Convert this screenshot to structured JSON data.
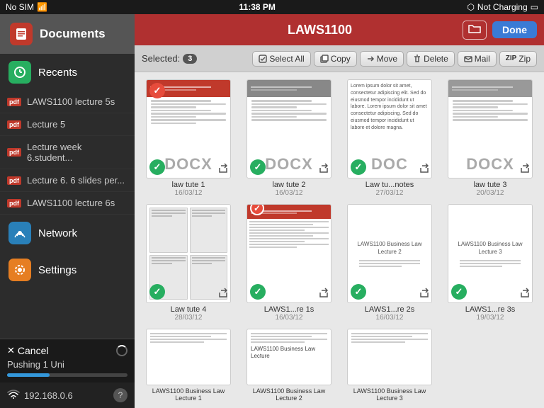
{
  "status_bar": {
    "left": "No SIM",
    "center": "11:38 PM",
    "right": "Not Charging"
  },
  "sidebar": {
    "title": "Documents",
    "documents_label": "Documents",
    "recents_label": "Recents",
    "pdf_items": [
      "LAWS1100 lecture 5s",
      "Lecture 5",
      "Lecture week 6.student...",
      "Lecture 6. 6 slides per...",
      "LAWS1100 lecture 6s"
    ],
    "network_label": "Network",
    "settings_label": "Settings",
    "cancel_label": "Cancel",
    "pushing_label": "Pushing 1 Uni",
    "wifi_label": "192.168.0.6"
  },
  "title_bar": {
    "title": "LAWS1100",
    "done_label": "Done"
  },
  "toolbar": {
    "selected_label": "Selected:",
    "selected_count": "3",
    "select_all_label": "Select All",
    "copy_label": "Copy",
    "move_label": "Move",
    "delete_label": "Delete",
    "mail_label": "Mail",
    "zip_label": "Zip"
  },
  "files": [
    {
      "name": "law tute 1",
      "date": "16/03/12",
      "type": "DOCX",
      "selected": true,
      "has_red_check": true,
      "row": 1
    },
    {
      "name": "law tute 2",
      "date": "16/03/12",
      "type": "DOCX",
      "selected": true,
      "has_red_check": false,
      "row": 1
    },
    {
      "name": "Law tu...notes",
      "date": "27/03/12",
      "type": "DOC",
      "selected": true,
      "has_red_check": false,
      "row": 1
    },
    {
      "name": "law tute 3",
      "date": "20/03/12",
      "type": "DOCX",
      "selected": false,
      "has_red_check": false,
      "row": 1
    },
    {
      "name": "Law tute 4",
      "date": "28/03/12",
      "type": "DOC_PREVIEW",
      "selected": true,
      "has_red_check": false,
      "row": 2
    },
    {
      "name": "LAWS1...re 1s",
      "date": "16/03/12",
      "type": "DOC_PREVIEW2",
      "selected": true,
      "has_red_check": true,
      "row": 2
    },
    {
      "name": "LAWS1...re 2s",
      "date": "16/03/12",
      "type": "PLAIN",
      "selected": true,
      "has_red_check": false,
      "row": 2,
      "label": "LAWS1100 Business Law Lecture 2"
    },
    {
      "name": "LAWS1...re 3s",
      "date": "19/03/12",
      "type": "PLAIN",
      "selected": false,
      "has_red_check": false,
      "row": 2,
      "label": "LAWS1100 Business Law Lecture 3"
    },
    {
      "name": "LAWS1100 Business Law Lecture 1",
      "date": "",
      "type": "PLAIN_SMALL",
      "selected": false,
      "row": 3
    },
    {
      "name": "LAWS1100 Business Law Lecture 2",
      "date": "",
      "type": "PLAIN_SMALL",
      "selected": false,
      "row": 3
    },
    {
      "name": "LAWS1100 Business Law Lecture 3",
      "date": "",
      "type": "PLAIN_SMALL",
      "selected": false,
      "row": 3
    }
  ]
}
